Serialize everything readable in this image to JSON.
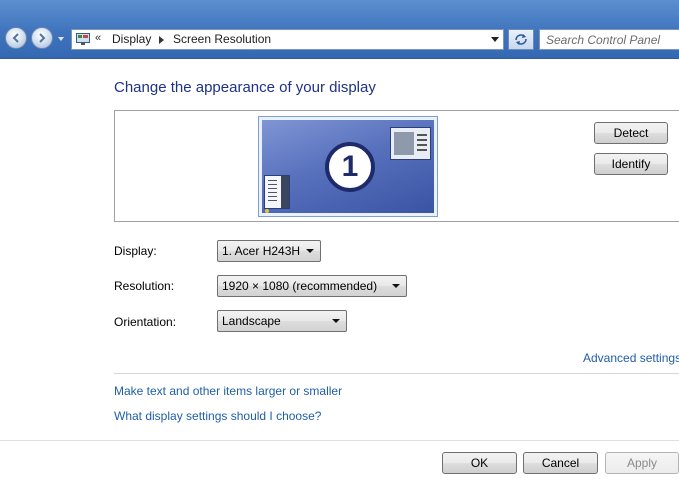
{
  "navbar": {
    "breadcrumb_prefix": "«",
    "breadcrumbs": [
      "Display",
      "Screen Resolution"
    ],
    "search_placeholder": "Search Control Panel"
  },
  "page": {
    "title": "Change the appearance of your display"
  },
  "preview": {
    "monitor_number": "1",
    "detect_label": "Detect",
    "identify_label": "Identify"
  },
  "settings": {
    "display_label": "Display:",
    "display_value": "1. Acer H243H",
    "resolution_label": "Resolution:",
    "resolution_value": "1920 × 1080 (recommended)",
    "orientation_label": "Orientation:",
    "orientation_value": "Landscape"
  },
  "links": {
    "advanced": "Advanced settings",
    "larger": "Make text and other items larger or smaller",
    "which": "What display settings should I choose?"
  },
  "footer": {
    "ok_label": "OK",
    "cancel_label": "Cancel",
    "apply_label": "Apply"
  },
  "colors": {
    "title": "#1e3287",
    "link": "#1f5ea8",
    "navbar": "#3f74bd"
  }
}
